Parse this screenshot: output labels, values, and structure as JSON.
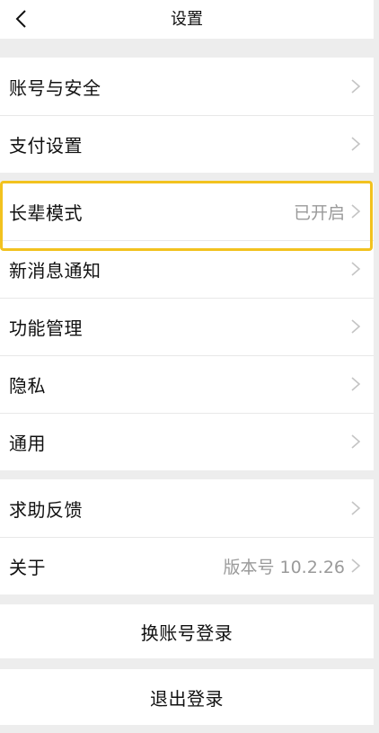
{
  "header": {
    "title": "设置"
  },
  "groups": [
    {
      "items": [
        {
          "label": "账号与安全"
        },
        {
          "label": "支付设置"
        }
      ]
    },
    {
      "items": [
        {
          "label": "长辈模式",
          "value": "已开启"
        },
        {
          "label": "新消息通知"
        },
        {
          "label": "功能管理"
        },
        {
          "label": "隐私"
        },
        {
          "label": "通用"
        }
      ]
    },
    {
      "items": [
        {
          "label": "求助反馈"
        },
        {
          "label": "关于",
          "value": "版本号 10.2.26"
        }
      ]
    }
  ],
  "actions": {
    "switch_account": "换账号登录",
    "logout": "退出登录"
  },
  "colors": {
    "highlight": "#f2c21f",
    "background": "#ededed"
  }
}
